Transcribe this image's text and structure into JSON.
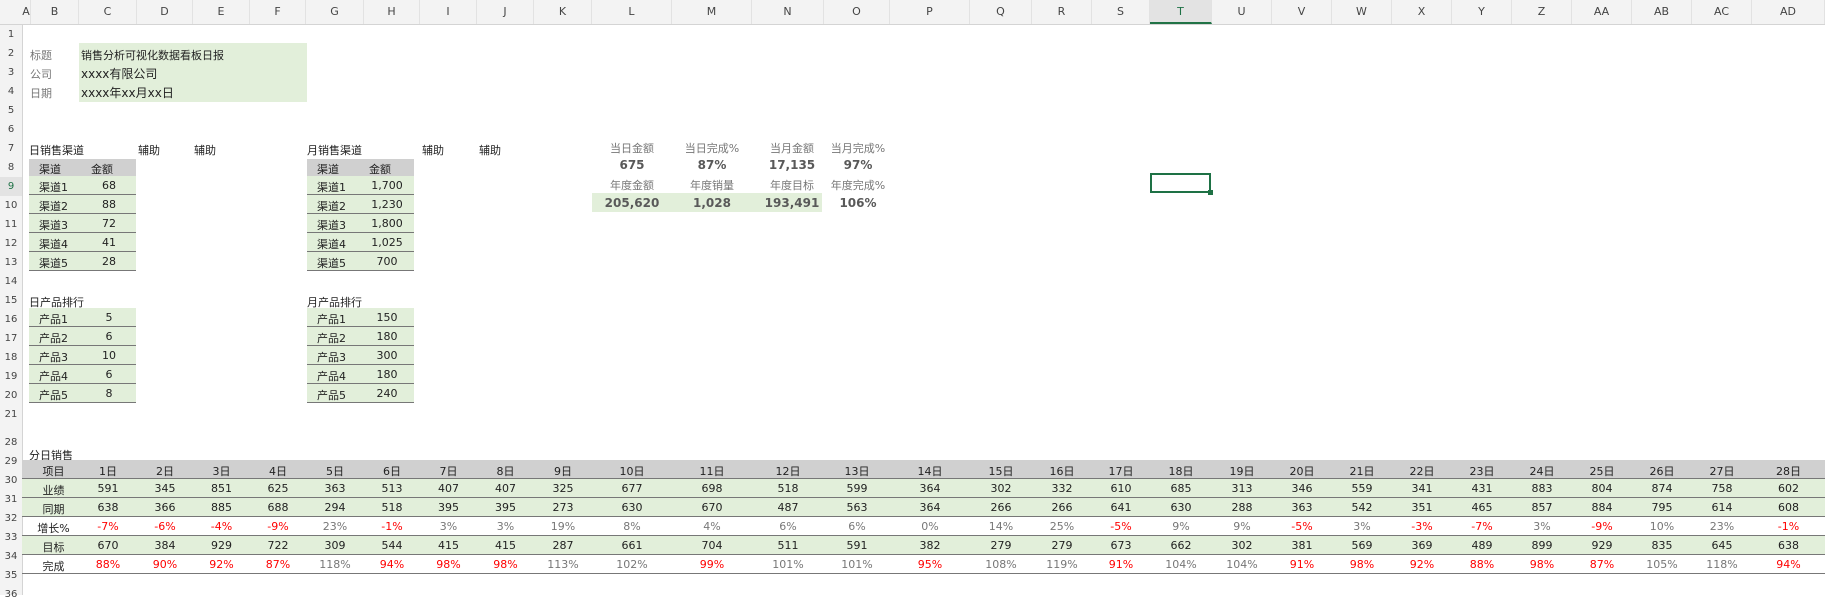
{
  "columns": [
    "A",
    "B",
    "C",
    "D",
    "E",
    "F",
    "G",
    "H",
    "I",
    "J",
    "K",
    "L",
    "M",
    "N",
    "O",
    "P",
    "Q",
    "R",
    "S",
    "T",
    "U",
    "V",
    "W",
    "X",
    "Y",
    "Z",
    "AA",
    "AB",
    "AC",
    "AD"
  ],
  "rows": [
    "1",
    "2",
    "3",
    "4",
    "5",
    "6",
    "7",
    "8",
    "9",
    "10",
    "11",
    "12",
    "13",
    "14",
    "15",
    "16",
    "17",
    "18",
    "19",
    "20",
    "21",
    "28",
    "29",
    "30",
    "31",
    "32",
    "33",
    "34",
    "35",
    "36"
  ],
  "selected_column": "T",
  "selected_row": "9",
  "info": {
    "title_label": "标题",
    "title_value": "销售分析可视化数据看板日报",
    "company_label": "公司",
    "company_value": "xxxx有限公司",
    "date_label": "日期",
    "date_value": "xxxx年xx月xx日"
  },
  "daily_channel": {
    "title": "日销售渠道",
    "aux1": "辅助",
    "aux2": "辅助",
    "h1": "渠道",
    "h2": "金额",
    "rows": [
      [
        "渠道1",
        "68"
      ],
      [
        "渠道2",
        "88"
      ],
      [
        "渠道3",
        "72"
      ],
      [
        "渠道4",
        "41"
      ],
      [
        "渠道5",
        "28"
      ]
    ]
  },
  "monthly_channel": {
    "title": "月销售渠道",
    "aux1": "辅助",
    "aux2": "辅助",
    "h1": "渠道",
    "h2": "金额",
    "rows": [
      [
        "渠道1",
        "1,700"
      ],
      [
        "渠道2",
        "1,230"
      ],
      [
        "渠道3",
        "1,800"
      ],
      [
        "渠道4",
        "1,025"
      ],
      [
        "渠道5",
        "700"
      ]
    ]
  },
  "kpi": {
    "l1": [
      "当日金额",
      "当日完成%",
      "当月金额",
      "当月完成%"
    ],
    "v1": [
      "675",
      "87%",
      "17,135",
      "97%"
    ],
    "l2": [
      "年度金额",
      "年度销量",
      "年度目标",
      "年度完成%"
    ],
    "v2": [
      "205,620",
      "1,028",
      "193,491",
      "106%"
    ]
  },
  "daily_product": {
    "title": "日产品排行",
    "rows": [
      [
        "产品1",
        "5"
      ],
      [
        "产品2",
        "6"
      ],
      [
        "产品3",
        "10"
      ],
      [
        "产品4",
        "6"
      ],
      [
        "产品5",
        "8"
      ]
    ]
  },
  "monthly_product": {
    "title": "月产品排行",
    "rows": [
      [
        "产品1",
        "150"
      ],
      [
        "产品2",
        "180"
      ],
      [
        "产品3",
        "300"
      ],
      [
        "产品4",
        "180"
      ],
      [
        "产品5",
        "240"
      ]
    ]
  },
  "daily_sales": {
    "title": "分日销售",
    "row_labels": [
      "项目",
      "业绩",
      "同期",
      "增长%",
      "目标",
      "完成"
    ],
    "days": [
      "1日",
      "2日",
      "3日",
      "4日",
      "5日",
      "6日",
      "7日",
      "8日",
      "9日",
      "10日",
      "11日",
      "12日",
      "13日",
      "14日",
      "15日",
      "16日",
      "17日",
      "18日",
      "19日",
      "20日",
      "21日",
      "22日",
      "23日",
      "24日",
      "25日",
      "26日",
      "27日",
      "28日"
    ],
    "actual": [
      "591",
      "345",
      "851",
      "625",
      "363",
      "513",
      "407",
      "407",
      "325",
      "677",
      "698",
      "518",
      "599",
      "364",
      "302",
      "332",
      "610",
      "685",
      "313",
      "346",
      "559",
      "341",
      "431",
      "883",
      "804",
      "874",
      "758",
      "602"
    ],
    "prior": [
      "638",
      "366",
      "885",
      "688",
      "294",
      "518",
      "395",
      "395",
      "273",
      "630",
      "670",
      "487",
      "563",
      "364",
      "266",
      "266",
      "641",
      "630",
      "288",
      "363",
      "542",
      "351",
      "465",
      "857",
      "884",
      "795",
      "614",
      "608"
    ],
    "growth": [
      "-7%",
      "-6%",
      "-4%",
      "-9%",
      "23%",
      "-1%",
      "3%",
      "3%",
      "19%",
      "8%",
      "4%",
      "6%",
      "6%",
      "0%",
      "14%",
      "25%",
      "-5%",
      "9%",
      "9%",
      "-5%",
      "3%",
      "-3%",
      "-7%",
      "3%",
      "-9%",
      "10%",
      "23%",
      "-1%"
    ],
    "target": [
      "670",
      "384",
      "929",
      "722",
      "309",
      "544",
      "415",
      "415",
      "287",
      "661",
      "704",
      "511",
      "591",
      "382",
      "279",
      "279",
      "673",
      "662",
      "302",
      "381",
      "569",
      "369",
      "489",
      "899",
      "929",
      "835",
      "645",
      "638"
    ],
    "completion": [
      "88%",
      "90%",
      "92%",
      "87%",
      "118%",
      "94%",
      "98%",
      "98%",
      "113%",
      "102%",
      "99%",
      "101%",
      "101%",
      "95%",
      "108%",
      "119%",
      "91%",
      "104%",
      "104%",
      "91%",
      "98%",
      "92%",
      "88%",
      "98%",
      "87%",
      "105%",
      "118%",
      "94%"
    ]
  }
}
